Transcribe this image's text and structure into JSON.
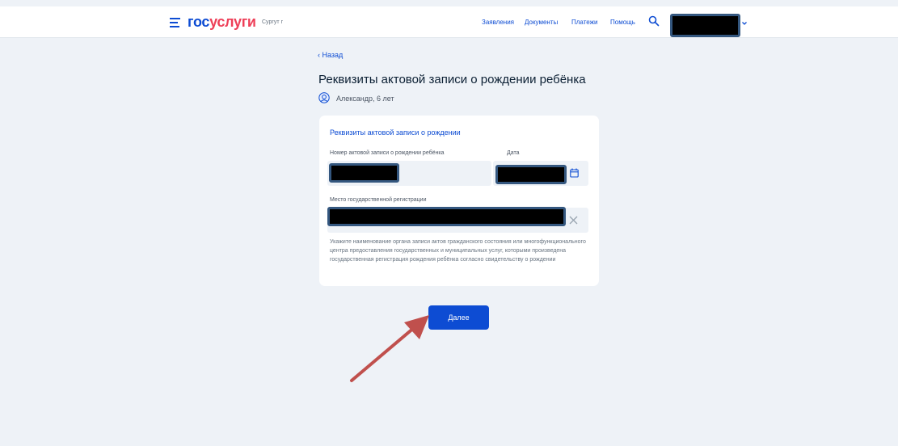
{
  "header": {
    "logo_part1": "гос",
    "logo_part2": "услуги",
    "city": "Сургут г",
    "nav": [
      "Заявления",
      "Документы",
      "Платежи",
      "Помощь"
    ]
  },
  "page": {
    "back_label": "Назад",
    "title": "Реквизиты актовой записи о рождении ребёнка",
    "child": "Александр, 6 лет"
  },
  "form": {
    "section_title": "Реквизиты актовой записи о рождении",
    "record_number_label": "Номер актовой записи о рождении ребёнка",
    "date_label": "Дата",
    "place_label": "Место государственной регистрации",
    "hint": "Укажите наименование органа записи актов гражданского состояния или многофункционального центра предоставления государственных и муниципальных услуг, которыми произведена государственная регистрация рождения ребёнка согласно свидетельству о рождении"
  },
  "actions": {
    "next_label": "Далее"
  },
  "colors": {
    "brand_blue": "#0d4cd3",
    "brand_red": "#ee3f58",
    "background": "#eef2f7",
    "annotation_arrow": "#c0504d"
  },
  "icons": [
    "menu-icon",
    "search-icon",
    "chevron-down-icon",
    "chevron-left-icon",
    "child-avatar-icon",
    "calendar-icon",
    "clear-icon",
    "annotation-arrow-icon"
  ]
}
